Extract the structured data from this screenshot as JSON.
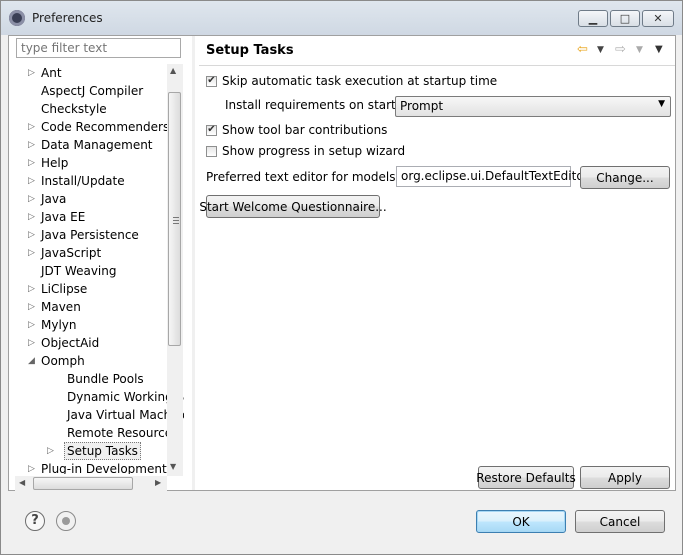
{
  "window": {
    "title": "Preferences"
  },
  "filter": {
    "placeholder": "type filter text"
  },
  "tree": {
    "items": [
      {
        "label": "Ant",
        "expand": "collapsed",
        "indent": 0
      },
      {
        "label": "AspectJ Compiler",
        "expand": "none",
        "indent": 0
      },
      {
        "label": "Checkstyle",
        "expand": "none",
        "indent": 0
      },
      {
        "label": "Code Recommenders",
        "expand": "collapsed",
        "indent": 0
      },
      {
        "label": "Data Management",
        "expand": "collapsed",
        "indent": 0
      },
      {
        "label": "Help",
        "expand": "collapsed",
        "indent": 0
      },
      {
        "label": "Install/Update",
        "expand": "collapsed",
        "indent": 0
      },
      {
        "label": "Java",
        "expand": "collapsed",
        "indent": 0
      },
      {
        "label": "Java EE",
        "expand": "collapsed",
        "indent": 0
      },
      {
        "label": "Java Persistence",
        "expand": "collapsed",
        "indent": 0
      },
      {
        "label": "JavaScript",
        "expand": "collapsed",
        "indent": 0
      },
      {
        "label": "JDT Weaving",
        "expand": "none",
        "indent": 0
      },
      {
        "label": "LiClipse",
        "expand": "collapsed",
        "indent": 0
      },
      {
        "label": "Maven",
        "expand": "collapsed",
        "indent": 0
      },
      {
        "label": "Mylyn",
        "expand": "collapsed",
        "indent": 0
      },
      {
        "label": "ObjectAid",
        "expand": "collapsed",
        "indent": 0
      },
      {
        "label": "Oomph",
        "expand": "expanded",
        "indent": 0
      },
      {
        "label": "Bundle Pools",
        "expand": "none",
        "indent": 1
      },
      {
        "label": "Dynamic Working Se",
        "expand": "none",
        "indent": 1
      },
      {
        "label": "Java Virtual Machine",
        "expand": "none",
        "indent": 1
      },
      {
        "label": "Remote Resources",
        "expand": "none",
        "indent": 1
      },
      {
        "label": "Setup Tasks",
        "expand": "collapsed",
        "indent": 1,
        "selected": true
      },
      {
        "label": "Plug-in Development",
        "expand": "collapsed",
        "indent": 0
      }
    ]
  },
  "page": {
    "title": "Setup Tasks",
    "skip_auto": {
      "label": "Skip automatic task execution at startup time",
      "checked": true
    },
    "install_req": {
      "label": "Install requirements on startup",
      "value": "Prompt"
    },
    "show_toolbar": {
      "label": "Show tool bar contributions",
      "checked": true
    },
    "show_progress": {
      "label": "Show progress in setup wizard",
      "checked": false
    },
    "pref_editor": {
      "label": "Preferred text editor for models",
      "value": "org.eclipse.ui.DefaultTextEditor",
      "change_label": "Change..."
    },
    "welcome_label": "Start Welcome Questionnaire...",
    "restore_label": "Restore Defaults",
    "apply_label": "Apply"
  },
  "dialog": {
    "ok_label": "OK",
    "cancel_label": "Cancel"
  },
  "icons": {
    "back": "back-arrow-icon",
    "forward": "forward-arrow-icon",
    "menu": "view-menu-icon",
    "help": "help-icon",
    "record": "record-icon"
  },
  "colors": {
    "back_arrow": "#e8a317",
    "forward_arrow": "#b0b0b0"
  }
}
